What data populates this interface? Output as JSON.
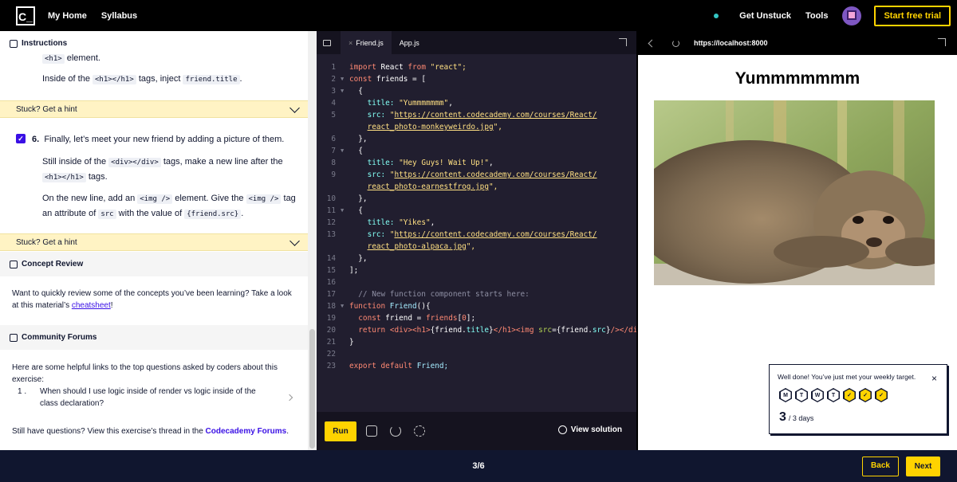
{
  "topbar": {
    "logo": "C_",
    "nav": [
      "My Home",
      "Syllabus"
    ],
    "get_unstuck": "Get Unstuck",
    "tools": "Tools",
    "trial": "Start free trial"
  },
  "instructions": {
    "title": "Instructions",
    "partial_code": "<h1>",
    "partial_text": " element.",
    "inject_pre": "Inside of the ",
    "inject_code1": "<h1></h1>",
    "inject_mid": " tags, inject ",
    "inject_code2": "friend.title",
    "inject_post": ".",
    "hint1": "Stuck? Get a hint",
    "step_num": "6.",
    "step_title": "Finally, let’s meet your new friend by adding a picture of them.",
    "p1_pre": "Still inside of the ",
    "p1_code1": "<div></div>",
    "p1_mid": " tags, make a new line after the ",
    "p1_code2": "<h1></h1>",
    "p1_post": " tags.",
    "p2_pre": "On the new line, add an ",
    "p2_code1": "<img />",
    "p2_mid": " element. Give the ",
    "p2_code2": "<img />",
    "p2_mid2": " tag an attribute of ",
    "p2_code3": "src",
    "p2_mid3": " with the value of ",
    "p2_code4": "{friend.src}",
    "p2_post": ".",
    "hint2": "Stuck? Get a hint"
  },
  "concept": {
    "title": "Concept Review",
    "text_pre": "Want to quickly review some of the concepts you’ve been learning? Take a look at this material’s ",
    "link": "cheatsheet",
    "text_post": "!"
  },
  "forums": {
    "title": "Community Forums",
    "intro": "Here are some helpful links to the top questions asked by coders about this exercise:",
    "q_num": "1 .",
    "q_text": "When should I use logic inside of render vs logic inside of the class declaration?",
    "footer_pre": "Still have questions? View this exercise’s thread in the ",
    "footer_link": "Codecademy Forums",
    "footer_post": "."
  },
  "editor": {
    "tabs": [
      "Friend.js",
      "App.js"
    ],
    "tab_close": "×",
    "run": "Run",
    "view_solution": "View solution"
  },
  "code_lines": [
    {
      "n": "1",
      "fold": ""
    },
    {
      "n": "2",
      "fold": "▼"
    },
    {
      "n": "3",
      "fold": "▼"
    },
    {
      "n": "4",
      "fold": ""
    },
    {
      "n": "5",
      "fold": ""
    },
    {
      "n": "",
      "fold": ""
    },
    {
      "n": "6",
      "fold": ""
    },
    {
      "n": "7",
      "fold": "▼"
    },
    {
      "n": "8",
      "fold": ""
    },
    {
      "n": "9",
      "fold": ""
    },
    {
      "n": "",
      "fold": ""
    },
    {
      "n": "10",
      "fold": ""
    },
    {
      "n": "11",
      "fold": "▼"
    },
    {
      "n": "12",
      "fold": ""
    },
    {
      "n": "13",
      "fold": ""
    },
    {
      "n": "",
      "fold": ""
    },
    {
      "n": "14",
      "fold": ""
    },
    {
      "n": "15",
      "fold": ""
    },
    {
      "n": "16",
      "fold": ""
    },
    {
      "n": "17",
      "fold": ""
    },
    {
      "n": "18",
      "fold": "▼"
    },
    {
      "n": "19",
      "fold": ""
    },
    {
      "n": "20",
      "fold": ""
    },
    {
      "n": "21",
      "fold": ""
    },
    {
      "n": "22",
      "fold": ""
    },
    {
      "n": "23",
      "fold": ""
    }
  ],
  "code": {
    "l1": [
      "import",
      " React ",
      "from",
      " \"react\";"
    ],
    "l2": [
      "const",
      " friends = ["
    ],
    "l3": "  {",
    "l4": [
      "    title: ",
      "\"Yummmmmmm\"",
      ","
    ],
    "l5": [
      "    src: ",
      "\"",
      "https://content.codecademy.com/courses/React/"
    ],
    "l5b": [
      "    ",
      "react_photo-monkeyweirdo.jpg",
      "\","
    ],
    "l6": "  },",
    "l7": "  {",
    "l8": [
      "    title: ",
      "\"Hey Guys! Wait Up!\"",
      ","
    ],
    "l9": [
      "    src: ",
      "\"",
      "https://content.codecademy.com/courses/React/"
    ],
    "l9b": [
      "    ",
      "react_photo-earnestfrog.jpg",
      "\","
    ],
    "l10": "  },",
    "l11": "  {",
    "l12": [
      "    title: ",
      "\"Yikes\"",
      ","
    ],
    "l13": [
      "    src: ",
      "\"",
      "https://content.codecademy.com/courses/React/"
    ],
    "l13b": [
      "    ",
      "react_photo-alpaca.jpg",
      "\","
    ],
    "l14": "  },",
    "l15": "];",
    "l17": "  // New function component starts here:",
    "l18": [
      "function",
      " Friend",
      "(){"
    ],
    "l19": [
      "  const",
      " friend = ",
      "friends",
      "[",
      "0",
      "];"
    ],
    "l20": [
      "  return",
      " ",
      "<div><h1>",
      "{friend.",
      "title",
      "}",
      "</h1><img ",
      "src",
      "={friend.",
      "src",
      "}",
      "/></div>"
    ],
    "l21": "}",
    "l23": [
      "export",
      " ",
      "default",
      " Friend;"
    ]
  },
  "browser": {
    "url": "https://localhost:8000",
    "heading": "Yummmmmmm"
  },
  "toast": {
    "message": "Well done! You’ve just met your weekly target.",
    "close": "×",
    "days": [
      {
        "label": "M",
        "done": false
      },
      {
        "label": "T",
        "done": false
      },
      {
        "label": "W",
        "done": false
      },
      {
        "label": "T",
        "done": false
      },
      {
        "label": "✓",
        "done": true
      },
      {
        "label": "✓",
        "done": true
      },
      {
        "label": "✓",
        "done": true
      }
    ],
    "count": "3",
    "count_suffix": "/ 3 days"
  },
  "bottom": {
    "progress": "3/6",
    "back": "Back",
    "next": "Next"
  },
  "colors": {
    "accent_yellow": "#ffd300",
    "navy": "#10162f",
    "hyper_purple": "#3a10e5"
  }
}
